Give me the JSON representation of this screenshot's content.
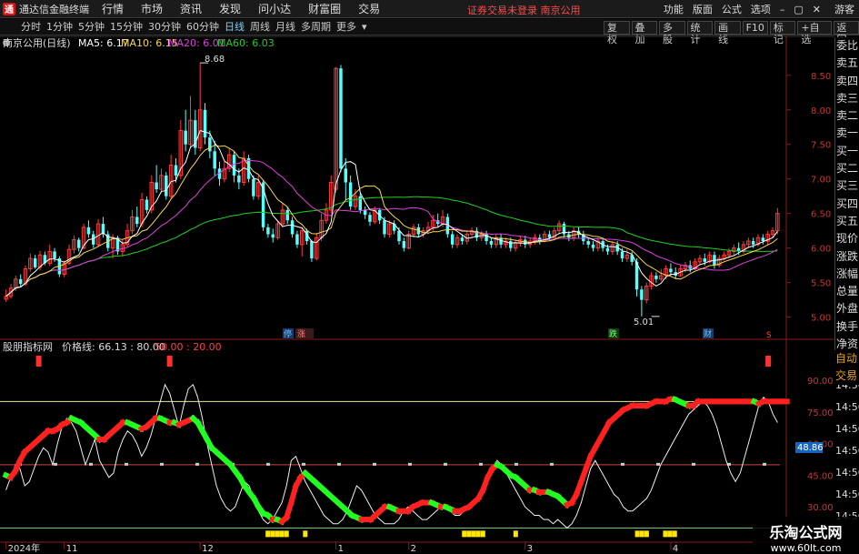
{
  "app": {
    "title": "通达信金融终端",
    "logo_char": "通"
  },
  "menu": [
    "行情",
    "市场",
    "资讯",
    "发现",
    "问小达",
    "财富圈",
    "交易"
  ],
  "status_warning": "证券交易未登录  南京公用",
  "right_menu": [
    "功能",
    "版面",
    "公式",
    "选项",
    "游客"
  ],
  "window_controls": {
    "min": "–",
    "max": "▢",
    "close": "✕"
  },
  "periods": [
    "分时",
    "1分钟",
    "5分钟",
    "15分钟",
    "30分钟",
    "60分钟",
    "日线",
    "周线",
    "月线",
    "多周期",
    "更多"
  ],
  "active_period": "日线",
  "toolbar_right": [
    "复权",
    "叠加",
    "多股",
    "统计",
    "画线",
    "F10",
    "标记",
    "+自选",
    "返回"
  ],
  "quote_header": {
    "stock": "南京公用(日线)",
    "ma5": "MA5: 6.17",
    "ma10": "MA10: 6.15",
    "ma20": "MA20: 6.01",
    "ma60": "MA60: 6.03",
    "colors": {
      "ma5": "#ffffff",
      "ma10": "#f7d94b",
      "ma20": "#e040e0",
      "ma60": "#1fd21f"
    }
  },
  "indicator_header": {
    "name": "股朋指标网",
    "label": "价格线: 66.13 : 80.00",
    "extra": "50.00 : 20.00"
  },
  "sidebar": [
    "委比",
    "卖五",
    "卖四",
    "卖三",
    "卖二",
    "卖一",
    "买一",
    "买二",
    "买三",
    "买四",
    "买五",
    "现价",
    "涨跌",
    "涨幅",
    "总量",
    "外盘",
    "换手",
    "净资",
    "收益"
  ],
  "sidebar_lower": [
    "自动",
    "交易"
  ],
  "right_axis_times": [
    "14:56",
    "14:56",
    "14:56",
    "14:56",
    "14:56",
    "14:56",
    "14:56",
    "14:56"
  ],
  "badges": {
    "price_tag": "48.86",
    "label_shengqing": "停",
    "label_tongzhi": "涨",
    "label_diang": "跌",
    "label_cai": "财",
    "label_s": "S"
  },
  "annotations": {
    "high": "8.68",
    "low": "5.01"
  },
  "chart_data": [
    {
      "type": "candlestick",
      "title": "南京公用(日线)",
      "y_ticks": [
        8.5,
        8.0,
        7.5,
        7.0,
        6.5,
        6.0,
        5.5,
        5.0
      ],
      "ylim": [
        4.85,
        8.8
      ],
      "x_labels": [
        "2024年",
        "11",
        "12",
        "1",
        "2",
        "3",
        "4",
        "5"
      ],
      "x_label_index": [
        0,
        12,
        40,
        68,
        83,
        107,
        137,
        165
      ],
      "candles": [
        [
          5.26,
          5.3,
          5.4,
          5.22
        ],
        [
          5.3,
          5.42,
          5.48,
          5.27
        ],
        [
          5.42,
          5.55,
          5.6,
          5.38
        ],
        [
          5.55,
          5.48,
          5.62,
          5.44
        ],
        [
          5.48,
          5.7,
          5.75,
          5.45
        ],
        [
          5.7,
          5.85,
          5.92,
          5.66
        ],
        [
          5.85,
          5.72,
          5.9,
          5.7
        ],
        [
          5.72,
          5.9,
          5.96,
          5.68
        ],
        [
          5.9,
          5.78,
          5.95,
          5.75
        ],
        [
          5.78,
          5.95,
          6.05,
          5.74
        ],
        [
          5.95,
          5.85,
          6.0,
          5.8
        ],
        [
          5.85,
          5.62,
          5.88,
          5.58
        ],
        [
          5.62,
          5.78,
          5.82,
          5.58
        ],
        [
          5.78,
          5.98,
          6.05,
          5.75
        ],
        [
          5.98,
          6.12,
          6.18,
          5.92
        ],
        [
          6.12,
          6.0,
          6.15,
          5.95
        ],
        [
          6.0,
          6.3,
          6.35,
          5.98
        ],
        [
          6.3,
          6.2,
          6.4,
          6.15
        ],
        [
          6.2,
          6.05,
          6.25,
          6.0
        ],
        [
          6.05,
          6.35,
          6.42,
          6.02
        ],
        [
          6.35,
          6.2,
          6.45,
          6.15
        ],
        [
          6.2,
          6.0,
          6.25,
          5.95
        ],
        [
          6.0,
          6.15,
          6.2,
          5.85
        ],
        [
          6.15,
          5.95,
          6.18,
          5.9
        ],
        [
          5.95,
          6.05,
          6.12,
          5.88
        ],
        [
          6.05,
          6.25,
          6.35,
          6.02
        ],
        [
          6.25,
          6.45,
          6.55,
          6.2
        ],
        [
          6.45,
          6.35,
          6.6,
          6.3
        ],
        [
          6.35,
          6.7,
          6.8,
          6.3
        ],
        [
          6.7,
          6.55,
          6.75,
          6.5
        ],
        [
          6.55,
          6.95,
          7.05,
          6.5
        ],
        [
          6.95,
          6.85,
          7.2,
          6.8
        ],
        [
          6.85,
          7.05,
          7.15,
          6.8
        ],
        [
          7.05,
          6.75,
          7.1,
          6.7
        ],
        [
          6.75,
          7.2,
          7.35,
          6.72
        ],
        [
          7.2,
          7.05,
          7.3,
          6.95
        ],
        [
          7.05,
          7.7,
          7.85,
          7.0
        ],
        [
          7.7,
          7.5,
          8.0,
          7.4
        ],
        [
          7.5,
          7.85,
          8.2,
          7.45
        ],
        [
          7.85,
          7.45,
          8.0,
          7.35
        ],
        [
          7.45,
          8.0,
          8.68,
          7.4
        ],
        [
          8.0,
          7.6,
          8.1,
          7.5
        ],
        [
          7.6,
          7.4,
          7.7,
          7.3
        ],
        [
          7.4,
          7.15,
          7.55,
          7.05
        ],
        [
          7.15,
          7.0,
          7.25,
          6.9
        ],
        [
          7.0,
          7.15,
          7.25,
          6.95
        ],
        [
          7.15,
          7.35,
          7.45,
          7.1
        ],
        [
          7.35,
          7.05,
          7.4,
          6.95
        ],
        [
          7.05,
          6.95,
          7.15,
          6.85
        ],
        [
          6.95,
          7.3,
          7.4,
          6.9
        ],
        [
          7.3,
          7.0,
          7.35,
          6.95
        ],
        [
          7.0,
          6.75,
          7.05,
          6.7
        ],
        [
          6.75,
          6.95,
          7.05,
          6.7
        ],
        [
          6.95,
          6.3,
          6.98,
          6.25
        ],
        [
          6.3,
          6.2,
          6.35,
          6.15
        ],
        [
          6.2,
          6.15,
          6.28,
          6.08
        ],
        [
          6.15,
          6.35,
          6.4,
          6.12
        ],
        [
          6.35,
          6.55,
          6.65,
          6.3
        ],
        [
          6.55,
          6.4,
          6.6,
          6.35
        ],
        [
          6.4,
          6.2,
          6.45,
          6.15
        ],
        [
          6.2,
          6.05,
          6.25,
          6.0
        ],
        [
          6.05,
          6.25,
          6.3,
          5.88
        ],
        [
          6.25,
          6.1,
          6.28,
          6.05
        ],
        [
          6.1,
          5.85,
          6.12,
          5.8
        ],
        [
          5.85,
          6.15,
          6.22,
          5.82
        ],
        [
          6.15,
          6.4,
          6.5,
          6.1
        ],
        [
          6.4,
          6.55,
          6.65,
          6.35
        ],
        [
          6.55,
          6.95,
          7.05,
          6.5
        ],
        [
          6.85,
          8.6,
          8.62,
          6.8
        ],
        [
          8.6,
          7.15,
          8.65,
          7.1
        ],
        [
          7.15,
          6.95,
          7.3,
          6.7
        ],
        [
          6.95,
          6.6,
          7.05,
          6.55
        ],
        [
          6.6,
          6.75,
          6.85,
          6.55
        ],
        [
          6.75,
          6.55,
          6.8,
          6.5
        ],
        [
          6.55,
          6.48,
          6.6,
          6.42
        ],
        [
          6.48,
          6.38,
          6.52,
          6.32
        ],
        [
          6.38,
          6.55,
          6.6,
          6.35
        ],
        [
          6.55,
          6.4,
          6.58,
          6.35
        ],
        [
          6.4,
          6.2,
          6.45,
          6.15
        ],
        [
          6.2,
          6.35,
          6.4,
          6.15
        ],
        [
          6.35,
          6.25,
          6.4,
          6.2
        ],
        [
          6.25,
          6.1,
          6.3,
          6.05
        ],
        [
          6.1,
          6.0,
          6.15,
          5.95
        ],
        [
          6.0,
          6.2,
          6.25,
          5.98
        ],
        [
          6.2,
          6.3,
          6.35,
          6.15
        ],
        [
          6.3,
          6.2,
          6.35,
          6.15
        ],
        [
          6.2,
          6.25,
          6.3,
          6.15
        ],
        [
          6.25,
          6.3,
          6.38,
          6.2
        ],
        [
          6.3,
          6.4,
          6.48,
          6.25
        ],
        [
          6.4,
          6.35,
          6.5,
          6.3
        ],
        [
          6.35,
          6.45,
          6.55,
          6.3
        ],
        [
          6.45,
          6.2,
          6.5,
          6.15
        ],
        [
          6.2,
          6.05,
          6.25,
          6.0
        ],
        [
          6.05,
          6.15,
          6.2,
          6.0
        ],
        [
          6.15,
          6.1,
          6.2,
          6.05
        ],
        [
          6.1,
          6.2,
          6.25,
          6.05
        ],
        [
          6.2,
          6.25,
          6.3,
          6.15
        ],
        [
          6.25,
          6.15,
          6.3,
          6.1
        ],
        [
          6.15,
          6.2,
          6.25,
          6.1
        ],
        [
          6.2,
          6.1,
          6.25,
          6.05
        ],
        [
          6.1,
          6.05,
          6.15,
          6.0
        ],
        [
          6.05,
          6.15,
          6.2,
          6.0
        ],
        [
          6.15,
          6.05,
          6.2,
          6.0
        ],
        [
          6.05,
          6.1,
          6.15,
          6.0
        ],
        [
          6.1,
          6.0,
          6.15,
          5.95
        ],
        [
          6.0,
          6.08,
          6.12,
          5.95
        ],
        [
          6.08,
          6.12,
          6.18,
          6.02
        ],
        [
          6.12,
          6.05,
          6.18,
          6.0
        ],
        [
          6.05,
          6.1,
          6.15,
          6.0
        ],
        [
          6.1,
          6.15,
          6.2,
          6.05
        ],
        [
          6.15,
          6.1,
          6.2,
          6.05
        ],
        [
          6.1,
          6.2,
          6.25,
          6.08
        ],
        [
          6.2,
          6.15,
          6.25,
          6.1
        ],
        [
          6.15,
          6.25,
          6.3,
          6.12
        ],
        [
          6.25,
          6.35,
          6.4,
          6.2
        ],
        [
          6.35,
          6.2,
          6.38,
          6.15
        ],
        [
          6.2,
          6.15,
          6.25,
          6.1
        ],
        [
          6.15,
          6.25,
          6.3,
          6.1
        ],
        [
          6.25,
          6.2,
          6.3,
          6.15
        ],
        [
          6.2,
          6.1,
          6.25,
          6.05
        ],
        [
          6.1,
          6.05,
          6.15,
          6.0
        ],
        [
          6.05,
          6.0,
          6.1,
          5.95
        ],
        [
          6.0,
          6.1,
          6.15,
          5.95
        ],
        [
          6.1,
          6.0,
          6.15,
          5.95
        ],
        [
          6.0,
          5.95,
          6.05,
          5.9
        ],
        [
          5.95,
          6.05,
          6.1,
          5.9
        ],
        [
          6.05,
          5.95,
          6.1,
          5.9
        ],
        [
          5.95,
          5.85,
          6.0,
          5.8
        ],
        [
          5.85,
          5.9,
          5.98,
          5.8
        ],
        [
          5.9,
          5.8,
          5.95,
          5.75
        ],
        [
          5.8,
          5.4,
          5.85,
          5.3
        ],
        [
          5.4,
          5.25,
          5.45,
          5.01
        ],
        [
          5.25,
          5.45,
          5.5,
          5.2
        ],
        [
          5.45,
          5.6,
          5.65,
          5.4
        ],
        [
          5.6,
          5.55,
          5.65,
          5.5
        ],
        [
          5.55,
          5.6,
          5.7,
          5.52
        ],
        [
          5.6,
          5.7,
          5.75,
          5.55
        ],
        [
          5.7,
          5.65,
          5.78,
          5.6
        ],
        [
          5.65,
          5.6,
          5.72,
          5.55
        ],
        [
          5.6,
          5.7,
          5.75,
          5.58
        ],
        [
          5.7,
          5.75,
          5.8,
          5.65
        ],
        [
          5.75,
          5.7,
          5.82,
          5.65
        ],
        [
          5.7,
          5.8,
          5.85,
          5.68
        ],
        [
          5.8,
          5.85,
          5.9,
          5.75
        ],
        [
          5.85,
          5.8,
          5.92,
          5.75
        ],
        [
          5.8,
          5.9,
          5.95,
          5.78
        ],
        [
          5.9,
          5.75,
          5.95,
          5.7
        ],
        [
          5.75,
          5.85,
          5.9,
          5.72
        ],
        [
          5.85,
          5.9,
          5.95,
          5.82
        ],
        [
          5.9,
          5.95,
          6.0,
          5.85
        ],
        [
          5.95,
          6.0,
          6.05,
          5.9
        ],
        [
          6.0,
          5.95,
          6.08,
          5.9
        ],
        [
          5.95,
          6.05,
          6.1,
          5.92
        ],
        [
          6.05,
          6.1,
          6.15,
          6.0
        ],
        [
          6.1,
          6.05,
          6.15,
          6.0
        ],
        [
          6.05,
          6.15,
          6.2,
          6.02
        ],
        [
          6.15,
          6.1,
          6.2,
          6.05
        ],
        [
          6.1,
          6.2,
          6.25,
          6.05
        ],
        [
          6.2,
          6.25,
          6.3,
          6.15
        ],
        [
          6.25,
          6.5,
          6.58,
          6.2
        ]
      ]
    },
    {
      "type": "line",
      "title": "股朋指标网",
      "y_ticks": [
        90.0,
        75.0,
        60.0,
        45.0,
        30.0
      ],
      "ylim": [
        18,
        100
      ],
      "ref_lines": [
        80,
        50,
        20
      ],
      "price_line": [
        45,
        44,
        47,
        52,
        56,
        58,
        60,
        62,
        64,
        66,
        66,
        67,
        69,
        70,
        72,
        71,
        70,
        68,
        66,
        64,
        62,
        62,
        64,
        66,
        68,
        70,
        70,
        69,
        68,
        67,
        68,
        70,
        72,
        72,
        71,
        70,
        70,
        69,
        70,
        71,
        72,
        70,
        66,
        62,
        58,
        56,
        54,
        52,
        50,
        47,
        44,
        40,
        37,
        34,
        30,
        27,
        26,
        24,
        24,
        23,
        25,
        32,
        40,
        44,
        46,
        44,
        42,
        40,
        38,
        36,
        34,
        32,
        30,
        28,
        26,
        25,
        24,
        24,
        24,
        26,
        28,
        30,
        30,
        29,
        28,
        28,
        28,
        30,
        31,
        32,
        32,
        32,
        31,
        30,
        30,
        29,
        28,
        28,
        29,
        30,
        32,
        34,
        38,
        44,
        48,
        50,
        49,
        47,
        45,
        44,
        42,
        40,
        38,
        38,
        37,
        37,
        37,
        36,
        35,
        33,
        31,
        32,
        36,
        42,
        48,
        54,
        58,
        62,
        66,
        70,
        72,
        74,
        76,
        77,
        78,
        78,
        78,
        78,
        79,
        80,
        80,
        80,
        81,
        81,
        80,
        79,
        78,
        78,
        80,
        80,
        80,
        80,
        80,
        80,
        80,
        80,
        80,
        80,
        80,
        80,
        80,
        79,
        80,
        80,
        80,
        80,
        80,
        80
      ],
      "white_line": [
        38,
        44,
        50,
        48,
        40,
        42,
        48,
        54,
        58,
        56,
        50,
        60,
        68,
        72,
        70,
        66,
        58,
        50,
        56,
        62,
        52,
        48,
        44,
        46,
        56,
        62,
        66,
        64,
        60,
        54,
        58,
        64,
        72,
        80,
        88,
        84,
        76,
        68,
        78,
        86,
        88,
        82,
        72,
        60,
        50,
        40,
        34,
        30,
        28,
        30,
        36,
        42,
        40,
        34,
        28,
        24,
        22,
        24,
        28,
        32,
        40,
        52,
        54,
        48,
        42,
        38,
        34,
        30,
        26,
        24,
        22,
        22,
        24,
        28,
        34,
        40,
        38,
        34,
        30,
        26,
        24,
        22,
        22,
        22,
        24,
        28,
        30,
        28,
        26,
        24,
        24,
        26,
        28,
        30,
        30,
        28,
        26,
        26,
        28,
        30,
        32,
        36,
        40,
        44,
        48,
        52,
        50,
        46,
        42,
        38,
        34,
        30,
        28,
        26,
        26,
        24,
        24,
        22,
        24,
        22,
        20,
        22,
        26,
        32,
        40,
        48,
        52,
        48,
        44,
        40,
        36,
        34,
        30,
        28,
        28,
        30,
        32,
        34,
        38,
        44,
        50,
        54,
        58,
        62,
        66,
        70,
        74,
        76,
        78,
        80,
        78,
        74,
        68,
        60,
        52,
        46,
        42,
        46,
        54,
        62,
        70,
        78,
        82,
        80,
        74,
        70
      ]
    }
  ]
}
